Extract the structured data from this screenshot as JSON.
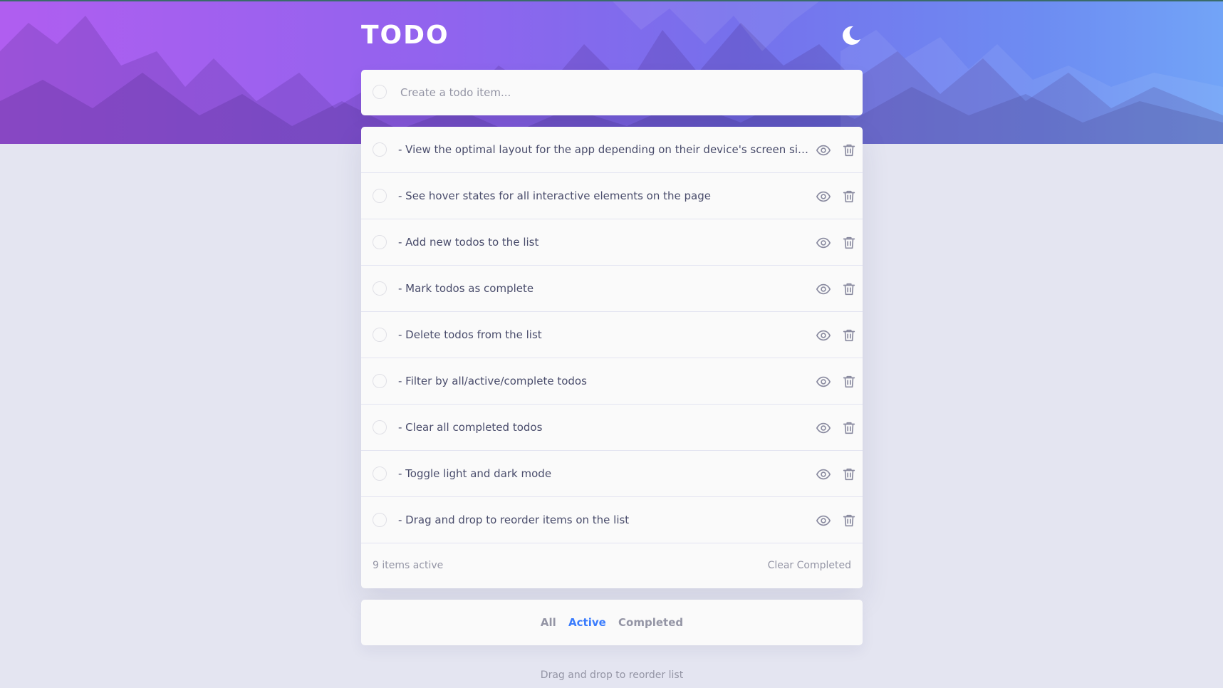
{
  "header": {
    "title": "TODO",
    "theme_icon": "moon-icon"
  },
  "create": {
    "placeholder": "Create a todo item..."
  },
  "todos": [
    {
      "text": "- View the optimal layout for the app depending on their device's screen size...",
      "completed": false
    },
    {
      "text": "- See hover states for all interactive elements on the page",
      "completed": false
    },
    {
      "text": "- Add new todos to the list",
      "completed": false
    },
    {
      "text": "- Mark todos as complete",
      "completed": false
    },
    {
      "text": "- Delete todos from the list",
      "completed": false
    },
    {
      "text": "- Filter by all/active/complete todos",
      "completed": false
    },
    {
      "text": "- Clear all completed todos",
      "completed": false
    },
    {
      "text": "- Toggle light and dark mode",
      "completed": false
    },
    {
      "text": "- Drag and drop to reorder items on the list",
      "completed": false
    }
  ],
  "item_icons": {
    "view": "eye-icon",
    "delete": "trash-icon"
  },
  "footer": {
    "items_left": "9 items active",
    "clear_label": "Clear Completed"
  },
  "filters": {
    "all": "All",
    "active": "Active",
    "completed": "Completed",
    "selected": "Active"
  },
  "hint": "Drag and drop to reorder list",
  "colors": {
    "accent": "#3a7cfd",
    "text": "#494c6b",
    "muted": "#9495a5",
    "background": "#e4e5f1",
    "card": "#fafafa",
    "gradient_start": "#b05ef0",
    "gradient_end": "#72a4f7"
  }
}
